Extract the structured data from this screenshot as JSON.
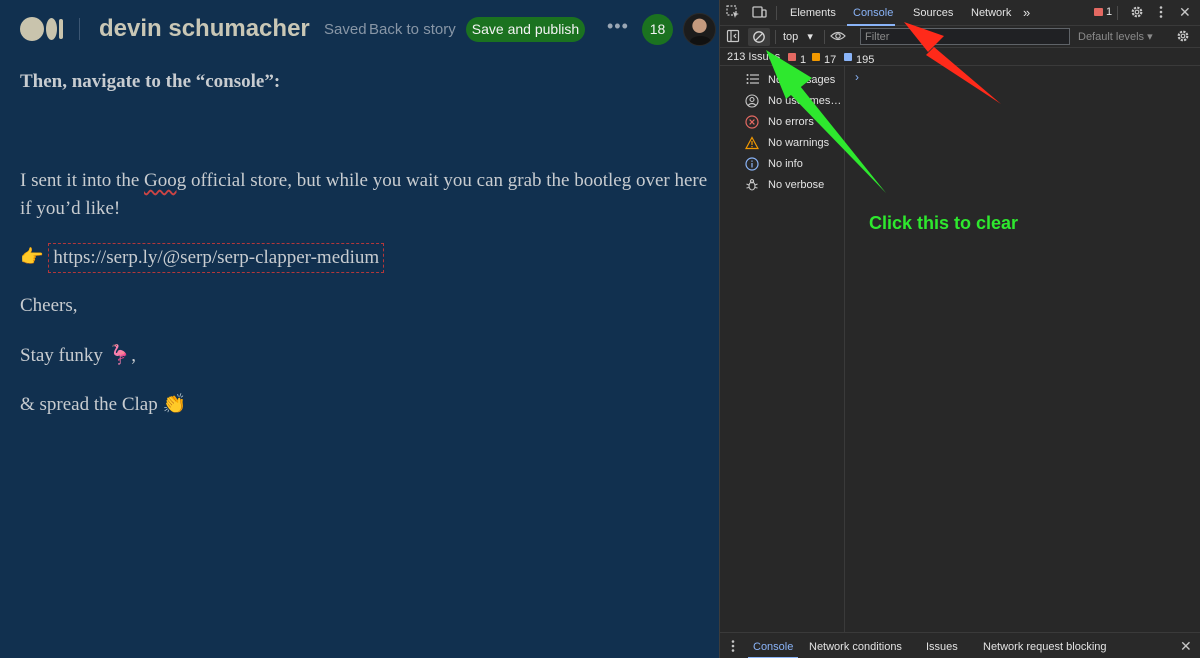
{
  "editor": {
    "author": "devin schumacher",
    "saved": "Saved",
    "back_link": "Back to story",
    "publish_button": "Save and publish",
    "more": "•••",
    "notifications": "18",
    "story": {
      "p1": "Then, navigate to the “console”:",
      "p2_before": "I sent it into the ",
      "p2_goog": "Goog",
      "p2_after": " official store, but while you wait you can grab the bootleg over here if you’d like!",
      "p3_emoji": "👉",
      "p3_link": "https://serp.ly/@serp/serp-clapper-medium",
      "p4": "Cheers,",
      "p5": "Stay funky 🦩,",
      "p6": "& spread the Clap 👏"
    }
  },
  "devtools": {
    "tabs": [
      "Elements",
      "Console",
      "Sources",
      "Network"
    ],
    "active_tab": "Console",
    "more_tabs": "»",
    "error_count": "1",
    "context": "top",
    "filter_placeholder": "Filter",
    "levels": "Default levels ▾",
    "issues": {
      "total": "213 Issues",
      "errors": "1",
      "warnings": "17",
      "info": "195"
    },
    "sidebar": [
      {
        "label": "No messages",
        "icon": "list-icon"
      },
      {
        "label": "No user messages",
        "icon": "user-icon"
      },
      {
        "label": "No errors",
        "icon": "error-icon"
      },
      {
        "label": "No warnings",
        "icon": "warning-icon"
      },
      {
        "label": "No info",
        "icon": "info-icon"
      },
      {
        "label": "No verbose",
        "icon": "bug-icon"
      }
    ],
    "prompt": "›",
    "drawer_tabs": [
      "Console",
      "Network conditions",
      "Issues",
      "Network request blocking"
    ]
  },
  "annotation": {
    "text": "Click this to clear",
    "green": "#2ee82e",
    "red": "#ff2a1a"
  },
  "colors": {
    "editor_bg": "#11304f",
    "publish_green": "#1b7220",
    "devtools_bg": "#282828",
    "devtools_accent": "#8ab4f8"
  }
}
